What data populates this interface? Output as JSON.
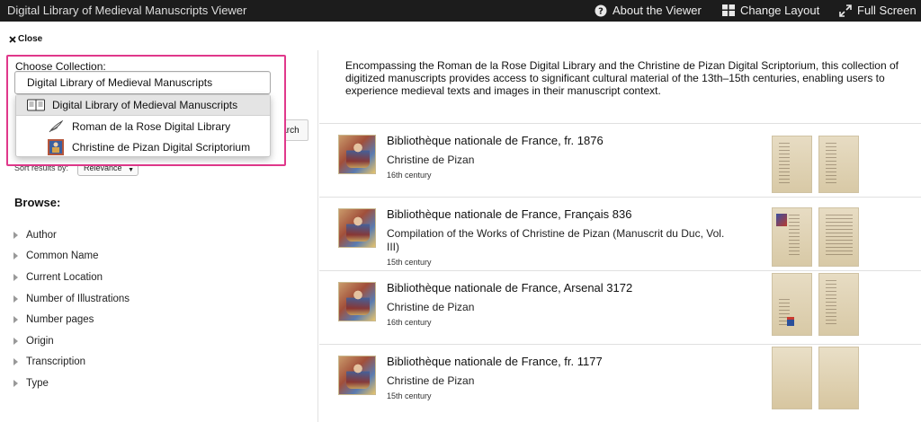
{
  "topbar": {
    "title": "Digital Library of Medieval Manuscripts Viewer",
    "about_label": "About the Viewer",
    "layout_label": "Change Layout",
    "fullscreen_label": "Full Screen"
  },
  "close_label": "Close",
  "collection": {
    "label": "Choose Collection:",
    "selected": "Digital Library of Medieval Manuscripts",
    "options": [
      {
        "label": "Digital Library of Medieval Manuscripts",
        "icon": "book-icon"
      },
      {
        "label": "Roman de la Rose Digital Library",
        "icon": "quill-icon"
      },
      {
        "label": "Christine de Pizan Digital Scriptorium",
        "icon": "miniature-icon"
      }
    ]
  },
  "search_label": "Search",
  "sort": {
    "label": "Sort results by:",
    "value": "Relevance"
  },
  "browse": {
    "title": "Browse:",
    "items": [
      "Author",
      "Common Name",
      "Current Location",
      "Number of Illustrations",
      "Number pages",
      "Origin",
      "Transcription",
      "Type"
    ]
  },
  "intro": "Encompassing the Roman de la Rose Digital Library and the Christine de Pizan Digital Scriptorium, this collection of digitized manuscripts provides access to significant cultural material of the 13th–15th centuries, enabling users to experience medieval texts and images in their manuscript context.",
  "results": [
    {
      "title": "Bibliothèque nationale de France, fr. 1876",
      "author": "Christine de Pizan",
      "century": "16th century"
    },
    {
      "title": "Bibliothèque nationale de France, Français 836",
      "author": "Compilation of the Works of Christine de Pizan (Manuscrit du Duc, Vol. III)",
      "century": "15th century"
    },
    {
      "title": "Bibliothèque nationale de France, Arsenal 3172",
      "author": "Christine de Pizan",
      "century": "16th century"
    },
    {
      "title": "Bibliothèque nationale de France, fr. 1177",
      "author": "Christine de Pizan",
      "century": "15th century"
    }
  ],
  "colors": {
    "topbar_bg": "#1c1c1c",
    "highlight_border": "#e0388b"
  }
}
